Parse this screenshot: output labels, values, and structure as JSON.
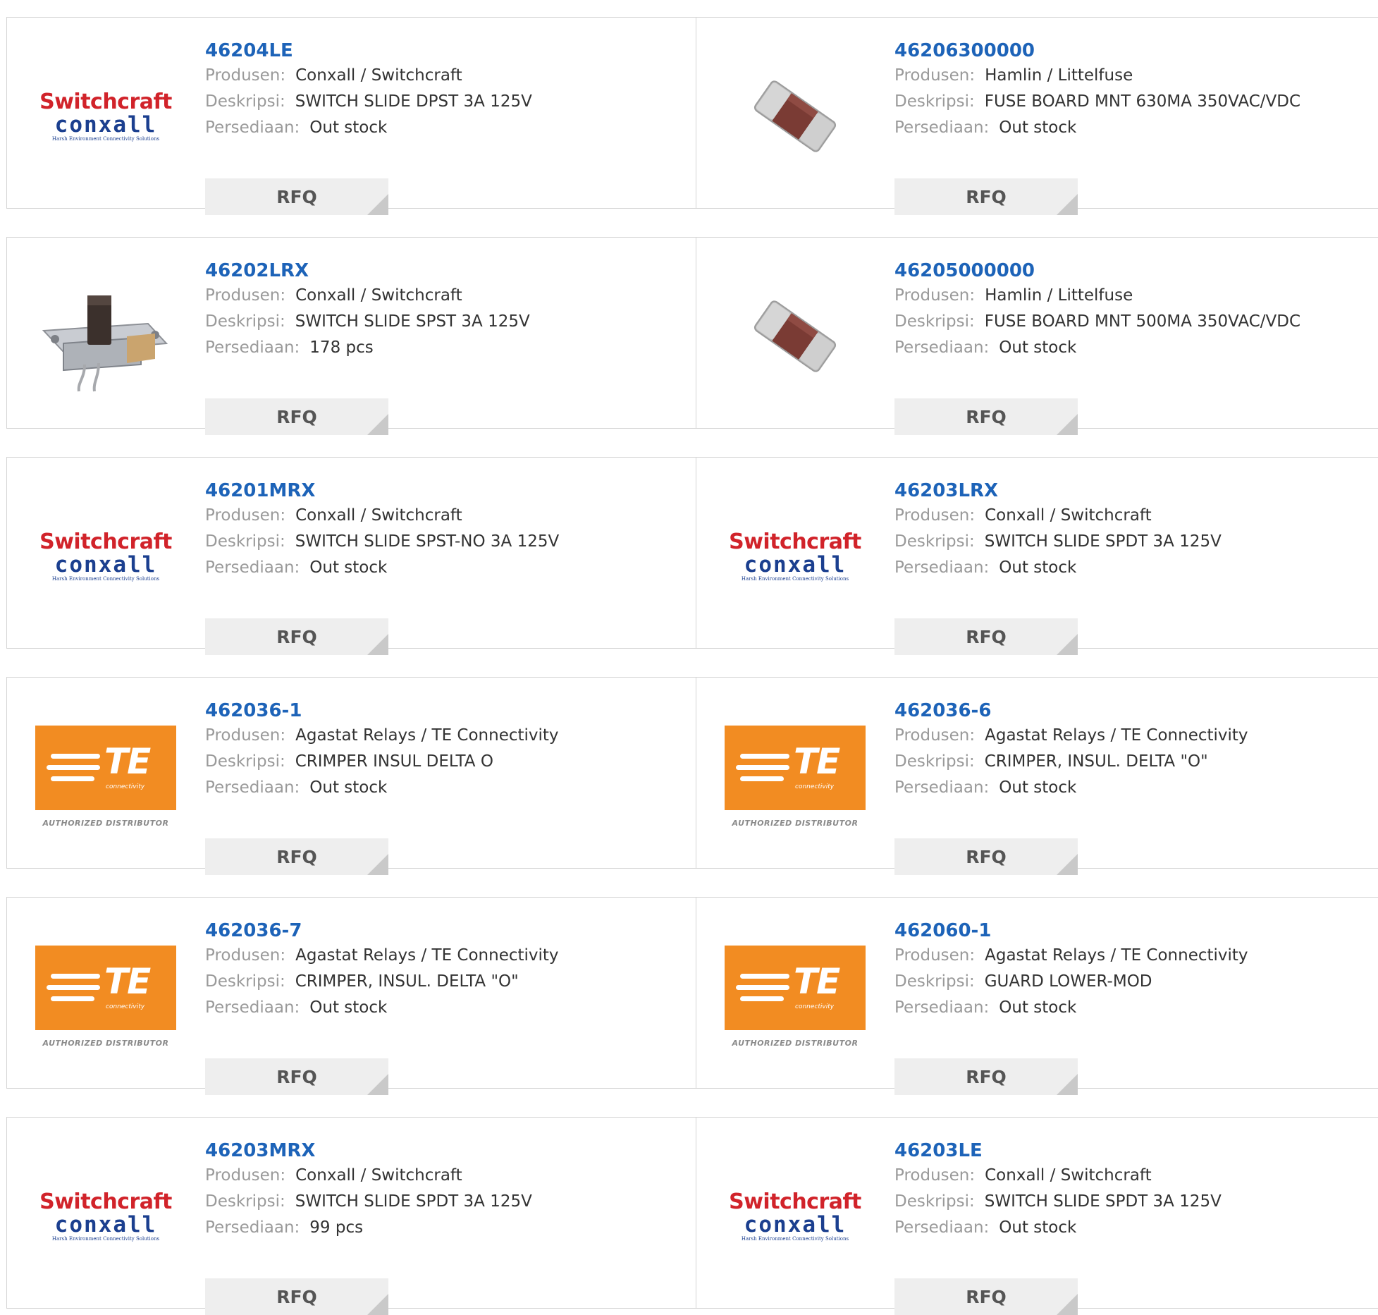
{
  "labels": {
    "manufacturer": "Produsen:",
    "description": "Deskripsi:",
    "stock": "Persediaan:",
    "rfq": "RFQ"
  },
  "logos": {
    "switchcraft": {
      "line1": "Switchcraft",
      "line2": "conxall",
      "line3": "Harsh Environment Connectivity Solutions"
    },
    "te": {
      "mark": "TE",
      "sub": "connectivity",
      "authorized": "AUTHORIZED DISTRIBUTOR"
    }
  },
  "products": [
    {
      "part": "46204LE",
      "manufacturer": "Conxall / Switchcraft",
      "description": "SWITCH SLIDE DPST 3A 125V",
      "stock": "Out stock",
      "image": "switchcraft-logo"
    },
    {
      "part": "46206300000",
      "manufacturer": "Hamlin / Littelfuse",
      "description": "FUSE BOARD MNT 630MA 350VAC/VDC",
      "stock": "Out stock",
      "image": "smd-fuse-photo"
    },
    {
      "part": "46202LRX",
      "manufacturer": "Conxall / Switchcraft",
      "description": "SWITCH SLIDE SPST 3A 125V",
      "stock": "178 pcs",
      "image": "slide-switch-photo"
    },
    {
      "part": "46205000000",
      "manufacturer": "Hamlin / Littelfuse",
      "description": "FUSE BOARD MNT 500MA 350VAC/VDC",
      "stock": "Out stock",
      "image": "smd-fuse-photo"
    },
    {
      "part": "46201MRX",
      "manufacturer": "Conxall / Switchcraft",
      "description": "SWITCH SLIDE SPST-NO 3A 125V",
      "stock": "Out stock",
      "image": "switchcraft-logo"
    },
    {
      "part": "46203LRX",
      "manufacturer": "Conxall / Switchcraft",
      "description": "SWITCH SLIDE SPDT 3A 125V",
      "stock": "Out stock",
      "image": "switchcraft-logo"
    },
    {
      "part": "462036-1",
      "manufacturer": "Agastat Relays / TE Connectivity",
      "description": "CRIMPER INSUL DELTA O",
      "stock": "Out stock",
      "image": "te-logo"
    },
    {
      "part": "462036-6",
      "manufacturer": "Agastat Relays / TE Connectivity",
      "description": "CRIMPER, INSUL. DELTA \"O\"",
      "stock": "Out stock",
      "image": "te-logo"
    },
    {
      "part": "462036-7",
      "manufacturer": "Agastat Relays / TE Connectivity",
      "description": "CRIMPER, INSUL. DELTA \"O\"",
      "stock": "Out stock",
      "image": "te-logo"
    },
    {
      "part": "462060-1",
      "manufacturer": "Agastat Relays / TE Connectivity",
      "description": "GUARD LOWER-MOD",
      "stock": "Out stock",
      "image": "te-logo"
    },
    {
      "part": "46203MRX",
      "manufacturer": "Conxall / Switchcraft",
      "description": "SWITCH SLIDE SPDT 3A 125V",
      "stock": "99 pcs",
      "image": "switchcraft-logo"
    },
    {
      "part": "46203LE",
      "manufacturer": "Conxall / Switchcraft",
      "description": "SWITCH SLIDE SPDT 3A 125V",
      "stock": "Out stock",
      "image": "switchcraft-logo"
    }
  ],
  "colors": {
    "part_link": "#1d63b8",
    "label": "#9a9a9a",
    "value": "#333333",
    "rfq_bg": "#eeeeee",
    "border": "#d4d4d4",
    "te_orange": "#f28c22",
    "switchcraft_red": "#d1232a",
    "conxall_blue": "#1b3f8f"
  }
}
